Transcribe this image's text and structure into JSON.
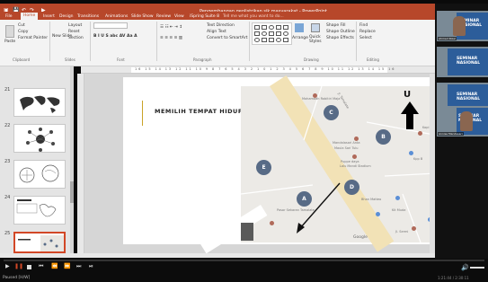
{
  "window": {
    "title": "Pengembangan geolistrikan sik masyarakat - PowerPoint"
  },
  "ribbon": {
    "tabs": [
      "File",
      "Home",
      "Insert",
      "Design",
      "Transitions",
      "Animations",
      "Slide Show",
      "Review",
      "View",
      "iSpring Suite 8"
    ],
    "tell_me": "Tell me what you want to do...",
    "clipboard": {
      "paste": "Paste",
      "cut": "Cut",
      "copy": "Copy",
      "format_painter": "Format Painter",
      "group": "Clipboard"
    },
    "slides": {
      "new_slide": "New Slide",
      "layout": "Layout",
      "reset": "Reset",
      "section": "Section",
      "group": "Slides"
    },
    "groups": {
      "font": "Font",
      "paragraph": "Paragraph",
      "drawing": "Drawing",
      "editing": "Editing"
    },
    "paragraph": {
      "text_direction": "Text Direction",
      "align_text": "Align Text",
      "smartart": "Convert to SmartArt"
    },
    "drawing": {
      "arrange": "Arrange",
      "quick_styles": "Quick Styles",
      "shape_fill": "Shape Fill",
      "shape_outline": "Shape Outline",
      "shape_effects": "Shape Effects"
    },
    "editing": {
      "find": "Find",
      "replace": "Replace",
      "select": "Select"
    }
  },
  "ruler_text": "16 15 14 13 12 11 10 9 8 7 6 5 4 3 2 1 0 1 2 3 4 5 6 7 8 9 10 11 12 13 14 15 16",
  "thumbnails": [
    {
      "number": "21"
    },
    {
      "number": "22"
    },
    {
      "number": "23"
    },
    {
      "number": "24"
    },
    {
      "number": "25"
    }
  ],
  "slide": {
    "title": "MEMILIH TEMPAT HIDUP",
    "map": {
      "points": [
        "A",
        "B",
        "C",
        "D",
        "E"
      ],
      "north": "U",
      "credit": "Google",
      "labels": [
        "Mohamadh Robitiri Maja",
        "Jl. Tamalate",
        "Mandalasari Anta",
        "Maula Sari Tulu",
        "Puppe daya",
        "Lalu Mandi Stadium",
        "Pasar Sekaran Tamalate",
        "Kopi",
        "Bhan Matteo",
        "Kpp B",
        "Kit Muda",
        "Jl. Sermi"
      ]
    }
  },
  "participants": [
    {
      "banner": "SEMINAR NASIONAL",
      "tag": "Ahmad Rizal"
    },
    {
      "banner": "SEMINAR NASIONAL",
      "tag": ""
    },
    {
      "banner": "SEMINAR NASIONAL",
      "tag": ""
    },
    {
      "banner": "SEMINAR NASIONAL",
      "tag": "Annisa Mandasari"
    }
  ],
  "player": {
    "status": "Paused [H/W]",
    "right_text": "1:21:44 / 2:30:11",
    "accent": "#b7472a"
  }
}
